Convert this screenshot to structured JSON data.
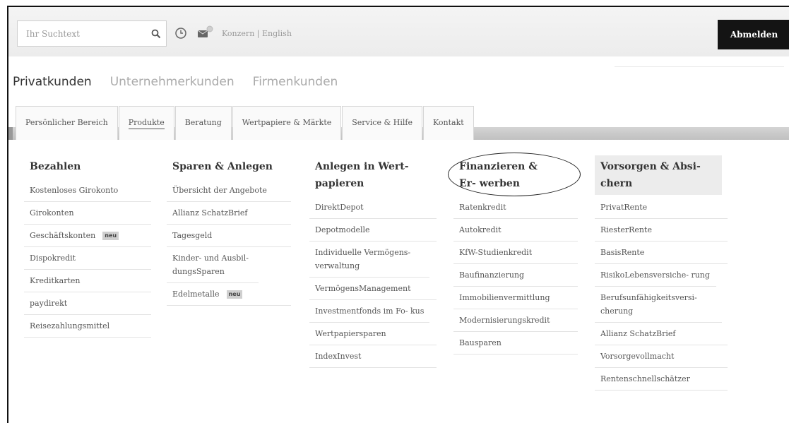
{
  "search": {
    "placeholder": "Ihr Suchtext"
  },
  "header": {
    "meta_links": "Konzern | English",
    "logout_label": "Abmelden"
  },
  "segments": [
    "Privatkunden",
    "Unternehmerkunden",
    "Firmenkunden"
  ],
  "tabs": [
    "Persönlicher Bereich",
    "Produkte",
    "Beratung",
    "Wertpapiere & Märkte",
    "Service & Hilfe",
    "Kontakt"
  ],
  "menu": [
    {
      "title": "Bezahlen",
      "items": [
        "Kostenloses Girokonto",
        "Girokonten",
        "Geschäftskonten",
        "Dispokredit",
        "Kreditkarten",
        "paydirekt",
        "Reisezahlungsmittel"
      ]
    },
    {
      "title": "Sparen & Anlegen",
      "items": [
        "Übersicht der Angebote",
        "Allianz SchatzBrief",
        "Tagesgeld",
        "Kinder- und Ausbil- dungsSparen",
        "Edelmetalle"
      ]
    },
    {
      "title": "Anlegen in Wert- papieren",
      "items": [
        "DirektDepot",
        "Depotmodelle",
        "Individuelle Vermögens- verwaltung",
        "VermögensManagement",
        "Investmentfonds im Fo- kus",
        "Wertpapiersparen",
        "IndexInvest"
      ]
    },
    {
      "title": "Finanzieren & Er- werben",
      "items": [
        "Ratenkredit",
        "Autokredit",
        "KfW-Studienkredit",
        "Baufinanzierung",
        "Immobilienvermittlung",
        "Modernisierungskredit",
        "Bausparen"
      ]
    },
    {
      "title": "Vorsorgen & Absi- chern",
      "items": [
        "PrivatRente",
        "RiesterRente",
        "BasisRente",
        "RisikoLebensversiche- rung",
        "Berufsunfähigkeitsversi- cherung",
        "Allianz SchatzBrief",
        "Vorsorgevollmacht",
        "Rentenschnellschätzer"
      ]
    }
  ],
  "badges": {
    "new": "neu"
  },
  "colors": {
    "logout_bg": "#141414",
    "tab_bar": "#c8c8c8",
    "highlight": "#ececec"
  }
}
